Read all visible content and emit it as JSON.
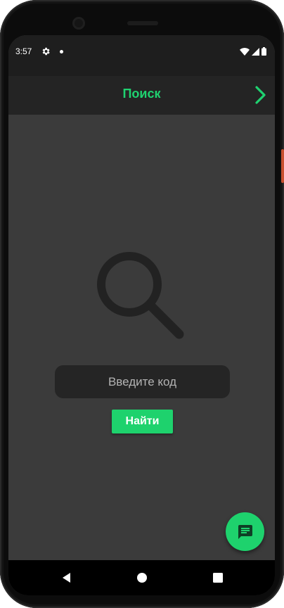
{
  "status_bar": {
    "time": "3:57",
    "icons": [
      "gear-icon",
      "notification-dot",
      "wifi-icon",
      "signal-icon",
      "battery-icon"
    ]
  },
  "app_bar": {
    "title": "Поиск",
    "forward_icon": "chevron-right-icon"
  },
  "search": {
    "illustration_icon": "magnifier-icon",
    "placeholder": "Введите код",
    "value": "",
    "submit_label": "Найти"
  },
  "fab": {
    "icon": "chat-icon"
  },
  "nav_bar": {
    "icons": [
      "back-icon",
      "home-icon",
      "recents-icon"
    ]
  },
  "colors": {
    "accent": "#1ed26d",
    "background": "#3b3b3b",
    "app_bar": "#242424",
    "input": "#252525",
    "illustration": "#222222"
  }
}
